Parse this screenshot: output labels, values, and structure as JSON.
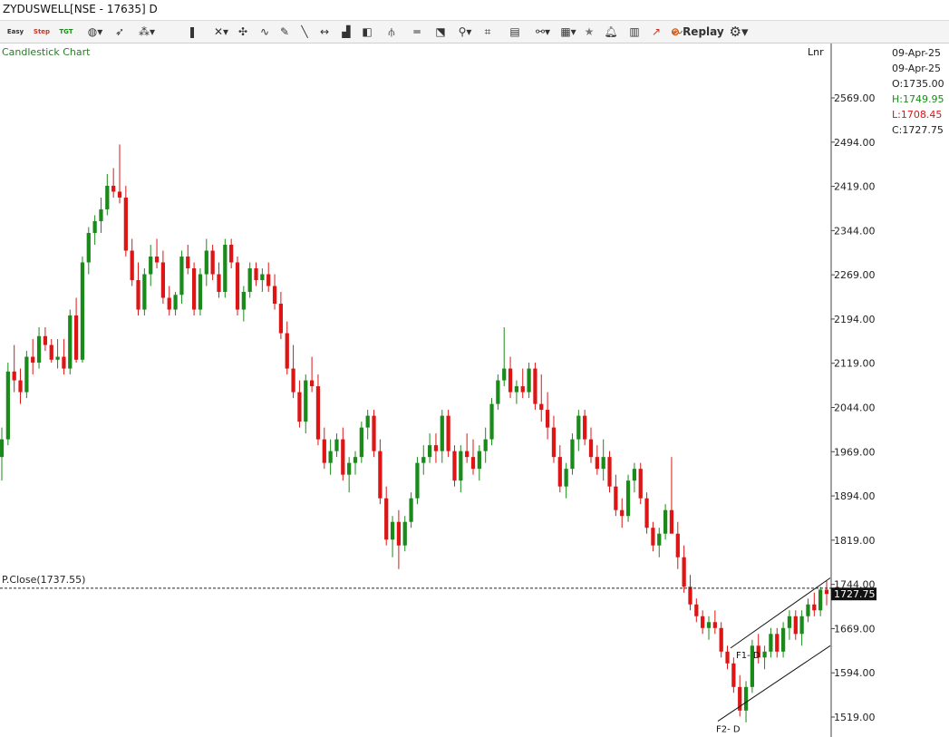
{
  "window": {
    "title": "ZYDUSWELL[NSE - 17635] D"
  },
  "toolbar": {
    "easy_label": "Easy",
    "step_label": "Step",
    "tgt_label": "TGT",
    "replay_label": "Replay",
    "icons": [
      "easy-icon",
      "step-icon",
      "tgt-icon",
      "globe-icon",
      "cursor-icon",
      "draw-tool-icon",
      "candle-type-icon",
      "crosshair-icon",
      "magnet-icon",
      "curve-icon",
      "pencil-icon",
      "line-icon",
      "hline-icon",
      "volume-bars-icon",
      "box-icon",
      "fork-icon",
      "parallel-lines-icon",
      "ruler-icon",
      "fib-icon",
      "template-icon",
      "pages-icon",
      "link-icon",
      "layout-icon",
      "star-icon",
      "bell-icon",
      "alert-icon",
      "indicator-icon",
      "trend-icon",
      "replay-icon",
      "settings-icon"
    ]
  },
  "chart_title": "Candlestick Chart",
  "scale_mode": "Lnr",
  "ohlc": {
    "date1": "09-Apr-25",
    "date2": "09-Apr-25",
    "open": "O:1735.00",
    "high": "H:1749.95",
    "low": "L:1708.45",
    "close": "C:1727.75"
  },
  "colors": {
    "up": "#1a8a1a",
    "down": "#dd1515",
    "high_text": "#1a8a1a",
    "low_text": "#dd1515",
    "title_text": "#2a7a2a"
  },
  "chart_data": {
    "type": "candlestick",
    "title": "Candlestick Chart",
    "y_ticks": [
      2569.0,
      2494.0,
      2419.0,
      2344.0,
      2269.0,
      2194.0,
      2119.0,
      2044.0,
      1969.0,
      1894.0,
      1819.0,
      1744.0,
      1669.0,
      1594.0,
      1519.0
    ],
    "y_tick_labels": [
      "2569.00",
      "2494.00",
      "2419.00",
      "2344.00",
      "2269.00",
      "2194.00",
      "2119.00",
      "2044.00",
      "1969.00",
      "1894.00",
      "1819.00",
      "1744.00",
      "1669.00",
      "1594.00",
      "1519.00"
    ],
    "ylim": [
      1497,
      2644
    ],
    "prev_close": {
      "label": "P.Close(1737.55)",
      "value": 1737.55
    },
    "last_price": {
      "label": "1727.75",
      "value": 1727.75
    },
    "annotations": [
      {
        "label": "F1- D",
        "value": 1625
      },
      {
        "label": "F2- D",
        "value": 1500
      }
    ],
    "channel": {
      "upper": [
        [
          1636,
          1755
        ]
      ],
      "lower": [
        [
          1512,
          1640
        ]
      ]
    },
    "candles": [
      [
        1960,
        2010,
        1920,
        1990
      ],
      [
        1990,
        2120,
        1980,
        2105
      ],
      [
        2105,
        2150,
        2070,
        2090
      ],
      [
        2090,
        2110,
        2050,
        2070
      ],
      [
        2070,
        2140,
        2060,
        2130
      ],
      [
        2130,
        2160,
        2100,
        2120
      ],
      [
        2120,
        2180,
        2110,
        2165
      ],
      [
        2165,
        2180,
        2140,
        2150
      ],
      [
        2150,
        2160,
        2120,
        2125
      ],
      [
        2125,
        2160,
        2110,
        2130
      ],
      [
        2130,
        2160,
        2100,
        2110
      ],
      [
        2110,
        2210,
        2100,
        2200
      ],
      [
        2200,
        2230,
        2120,
        2125
      ],
      [
        2125,
        2300,
        2120,
        2290
      ],
      [
        2290,
        2350,
        2270,
        2340
      ],
      [
        2340,
        2370,
        2320,
        2360
      ],
      [
        2360,
        2400,
        2340,
        2380
      ],
      [
        2380,
        2440,
        2370,
        2420
      ],
      [
        2420,
        2450,
        2400,
        2410
      ],
      [
        2410,
        2490,
        2390,
        2400
      ],
      [
        2400,
        2420,
        2300,
        2310
      ],
      [
        2310,
        2330,
        2250,
        2260
      ],
      [
        2260,
        2290,
        2200,
        2210
      ],
      [
        2210,
        2280,
        2200,
        2270
      ],
      [
        2270,
        2320,
        2250,
        2300
      ],
      [
        2300,
        2330,
        2280,
        2290
      ],
      [
        2290,
        2310,
        2220,
        2230
      ],
      [
        2230,
        2250,
        2200,
        2210
      ],
      [
        2210,
        2240,
        2200,
        2235
      ],
      [
        2235,
        2310,
        2220,
        2300
      ],
      [
        2300,
        2320,
        2270,
        2280
      ],
      [
        2280,
        2290,
        2200,
        2210
      ],
      [
        2210,
        2280,
        2200,
        2270
      ],
      [
        2270,
        2330,
        2250,
        2310
      ],
      [
        2310,
        2320,
        2260,
        2270
      ],
      [
        2270,
        2290,
        2230,
        2240
      ],
      [
        2240,
        2330,
        2230,
        2320
      ],
      [
        2320,
        2330,
        2280,
        2290
      ],
      [
        2290,
        2300,
        2200,
        2210
      ],
      [
        2210,
        2250,
        2190,
        2240
      ],
      [
        2240,
        2290,
        2230,
        2280
      ],
      [
        2280,
        2290,
        2250,
        2260
      ],
      [
        2260,
        2280,
        2240,
        2270
      ],
      [
        2270,
        2290,
        2240,
        2250
      ],
      [
        2250,
        2270,
        2210,
        2220
      ],
      [
        2220,
        2240,
        2160,
        2170
      ],
      [
        2170,
        2190,
        2100,
        2110
      ],
      [
        2110,
        2150,
        2060,
        2070
      ],
      [
        2070,
        2090,
        2010,
        2020
      ],
      [
        2020,
        2100,
        2000,
        2090
      ],
      [
        2090,
        2130,
        2070,
        2080
      ],
      [
        2080,
        2100,
        1980,
        1990
      ],
      [
        1990,
        2010,
        1940,
        1950
      ],
      [
        1950,
        1990,
        1930,
        1970
      ],
      [
        1970,
        2000,
        1960,
        1990
      ],
      [
        1990,
        2010,
        1920,
        1930
      ],
      [
        1930,
        1960,
        1900,
        1950
      ],
      [
        1950,
        1970,
        1930,
        1960
      ],
      [
        1960,
        2020,
        1950,
        2010
      ],
      [
        2010,
        2040,
        1990,
        2030
      ],
      [
        2030,
        2040,
        1960,
        1970
      ],
      [
        1970,
        1990,
        1880,
        1890
      ],
      [
        1890,
        1910,
        1810,
        1820
      ],
      [
        1820,
        1860,
        1790,
        1850
      ],
      [
        1850,
        1870,
        1770,
        1810
      ],
      [
        1810,
        1860,
        1800,
        1850
      ],
      [
        1850,
        1900,
        1840,
        1890
      ],
      [
        1890,
        1960,
        1880,
        1950
      ],
      [
        1950,
        1980,
        1930,
        1960
      ],
      [
        1960,
        2000,
        1950,
        1980
      ],
      [
        1980,
        2000,
        1950,
        1970
      ],
      [
        1970,
        2040,
        1950,
        2030
      ],
      [
        2030,
        2040,
        1960,
        1970
      ],
      [
        1970,
        1980,
        1910,
        1920
      ],
      [
        1920,
        1980,
        1900,
        1970
      ],
      [
        1970,
        2000,
        1950,
        1960
      ],
      [
        1960,
        1990,
        1930,
        1940
      ],
      [
        1940,
        1980,
        1920,
        1970
      ],
      [
        1970,
        2010,
        1950,
        1990
      ],
      [
        1990,
        2060,
        1980,
        2050
      ],
      [
        2050,
        2100,
        2040,
        2090
      ],
      [
        2090,
        2180,
        2080,
        2110
      ],
      [
        2110,
        2130,
        2060,
        2070
      ],
      [
        2070,
        2090,
        2050,
        2080
      ],
      [
        2080,
        2110,
        2060,
        2070
      ],
      [
        2070,
        2120,
        2060,
        2110
      ],
      [
        2110,
        2120,
        2040,
        2050
      ],
      [
        2050,
        2100,
        2020,
        2040
      ],
      [
        2040,
        2070,
        1990,
        2010
      ],
      [
        2010,
        2030,
        1950,
        1960
      ],
      [
        1960,
        1980,
        1900,
        1910
      ],
      [
        1910,
        1950,
        1890,
        1940
      ],
      [
        1940,
        2000,
        1930,
        1990
      ],
      [
        1990,
        2040,
        1970,
        2030
      ],
      [
        2030,
        2040,
        1980,
        1990
      ],
      [
        1990,
        2010,
        1950,
        1960
      ],
      [
        1960,
        1980,
        1930,
        1940
      ],
      [
        1940,
        1990,
        1920,
        1960
      ],
      [
        1960,
        1970,
        1900,
        1910
      ],
      [
        1910,
        1930,
        1860,
        1870
      ],
      [
        1870,
        1890,
        1840,
        1860
      ],
      [
        1860,
        1930,
        1850,
        1920
      ],
      [
        1920,
        1950,
        1900,
        1940
      ],
      [
        1940,
        1950,
        1880,
        1890
      ],
      [
        1890,
        1900,
        1830,
        1840
      ],
      [
        1840,
        1850,
        1800,
        1810
      ],
      [
        1810,
        1840,
        1790,
        1830
      ],
      [
        1830,
        1880,
        1820,
        1870
      ],
      [
        1870,
        1960,
        1860,
        1830
      ],
      [
        1830,
        1850,
        1770,
        1790
      ],
      [
        1790,
        1810,
        1730,
        1740
      ],
      [
        1740,
        1760,
        1700,
        1710
      ],
      [
        1710,
        1720,
        1680,
        1690
      ],
      [
        1690,
        1700,
        1660,
        1670
      ],
      [
        1670,
        1690,
        1650,
        1680
      ],
      [
        1680,
        1700,
        1660,
        1670
      ],
      [
        1670,
        1680,
        1620,
        1630
      ],
      [
        1630,
        1640,
        1600,
        1610
      ],
      [
        1610,
        1620,
        1560,
        1570
      ],
      [
        1570,
        1590,
        1520,
        1530
      ],
      [
        1530,
        1580,
        1510,
        1570
      ],
      [
        1570,
        1650,
        1560,
        1640
      ],
      [
        1640,
        1660,
        1610,
        1620
      ],
      [
        1620,
        1640,
        1600,
        1630
      ],
      [
        1630,
        1670,
        1620,
        1660
      ],
      [
        1660,
        1670,
        1620,
        1630
      ],
      [
        1630,
        1680,
        1620,
        1670
      ],
      [
        1670,
        1700,
        1650,
        1690
      ],
      [
        1690,
        1700,
        1650,
        1660
      ],
      [
        1660,
        1700,
        1640,
        1690
      ],
      [
        1690,
        1720,
        1680,
        1710
      ],
      [
        1710,
        1730,
        1690,
        1700
      ],
      [
        1700,
        1740,
        1690,
        1735
      ],
      [
        1735,
        1749.95,
        1708.45,
        1727.75
      ]
    ]
  }
}
